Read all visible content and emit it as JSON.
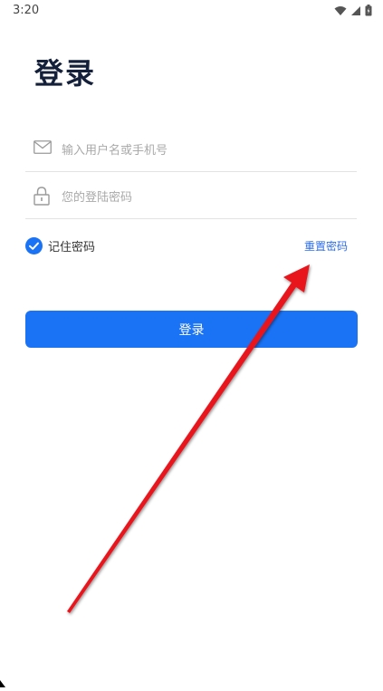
{
  "status_bar": {
    "time": "3:20",
    "icons": [
      "wifi-icon",
      "signal-icon",
      "battery-icon"
    ]
  },
  "login": {
    "title": "登录",
    "username": {
      "placeholder": "输入用户名或手机号",
      "value": "",
      "icon": "mail-icon"
    },
    "password": {
      "placeholder": "您的登陆密码",
      "value": "",
      "icon": "lock-icon"
    },
    "remember": {
      "label": "记住密码",
      "checked": true
    },
    "reset_link": "重置密码",
    "submit_label": "登录"
  },
  "colors": {
    "primary": "#1a73f5",
    "link": "#2d6ee6",
    "title": "#14203a",
    "annotation_arrow": "#e8141c"
  }
}
